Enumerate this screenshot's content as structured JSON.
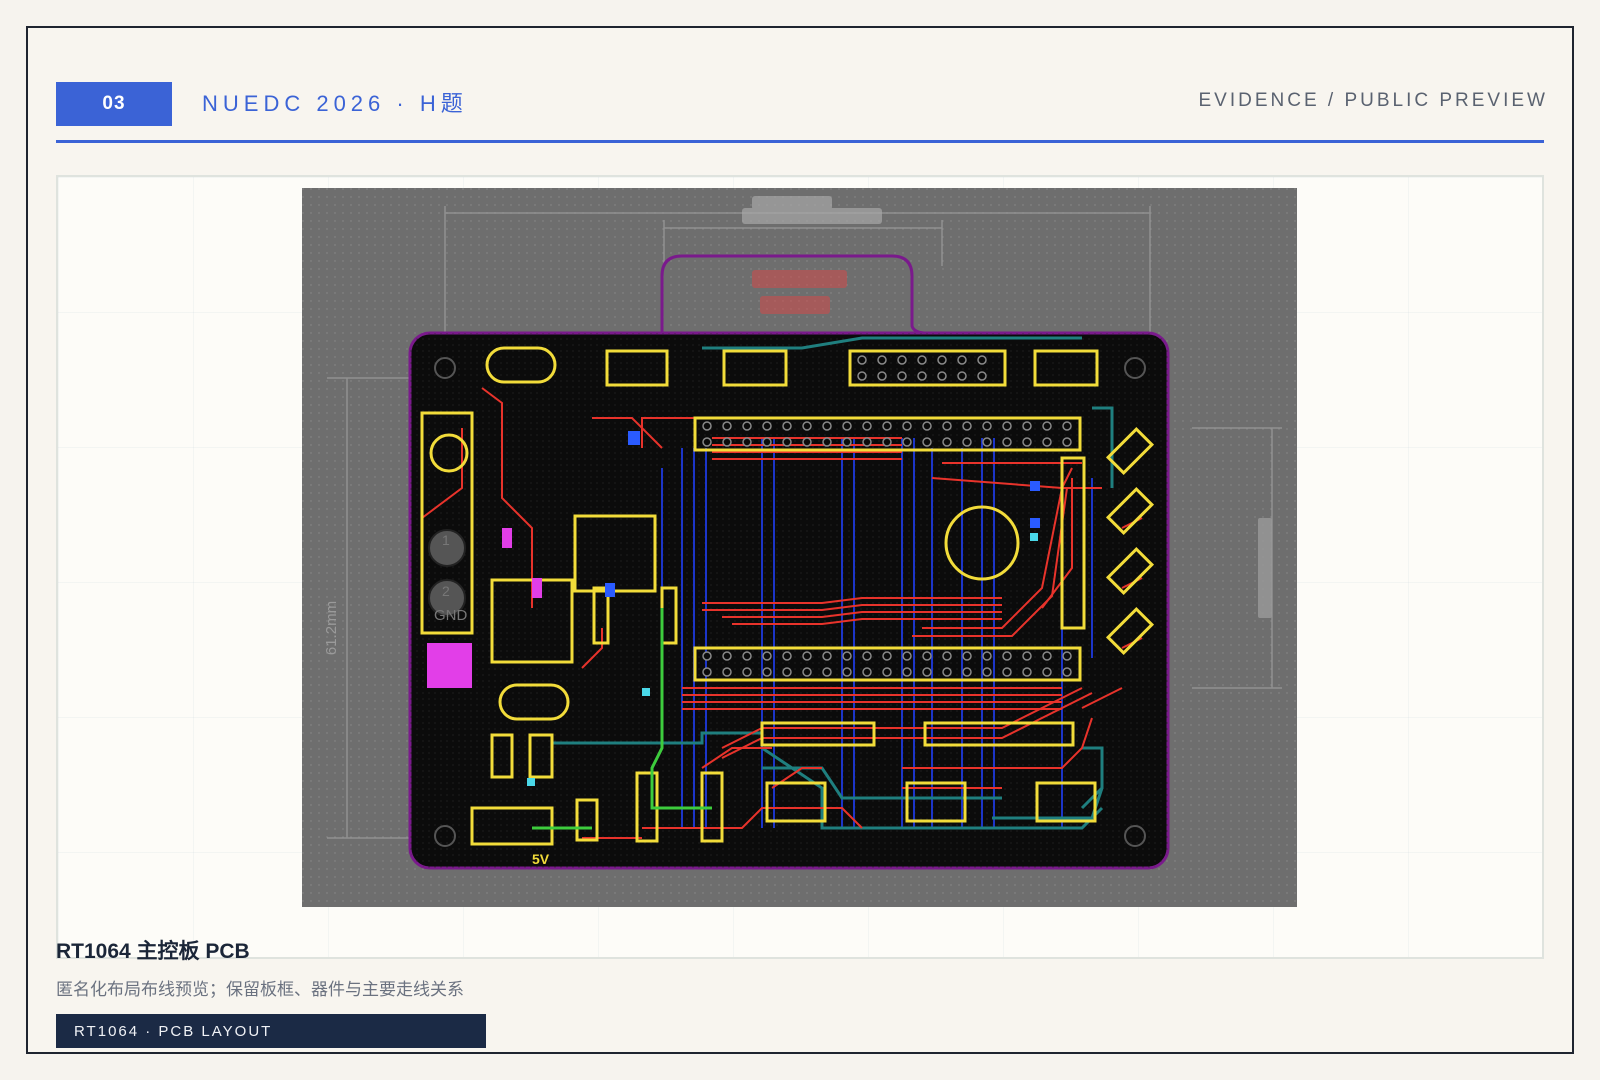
{
  "header": {
    "slide_number": "03",
    "title": "NUEDC 2026 · H题",
    "section_label": "EVIDENCE / PUBLIC PREVIEW"
  },
  "figure": {
    "caption_title": "RT1064 主控板 PCB",
    "caption_description": "匿名化布局布线预览；保留板框、器件与主要走线关系",
    "tag_label": "RT1064 · PCB LAYOUT",
    "board_labels": {
      "silk_5v": "5V",
      "silk_gnd": "GND",
      "silk_pin_1": "1",
      "silk_pin_2": "2",
      "dim_height": "61.2mm"
    }
  },
  "colors": {
    "accent": "#3b63d6",
    "tag_bg": "#1b2a45",
    "board_bg": "#0b0b0b",
    "outline": "#7a1a8c",
    "silkscreen": "#f2dc3a",
    "top_copper": "#e8332b",
    "bottom_copper": "#1c35c8",
    "inner_trace": "#1f7f7f"
  }
}
